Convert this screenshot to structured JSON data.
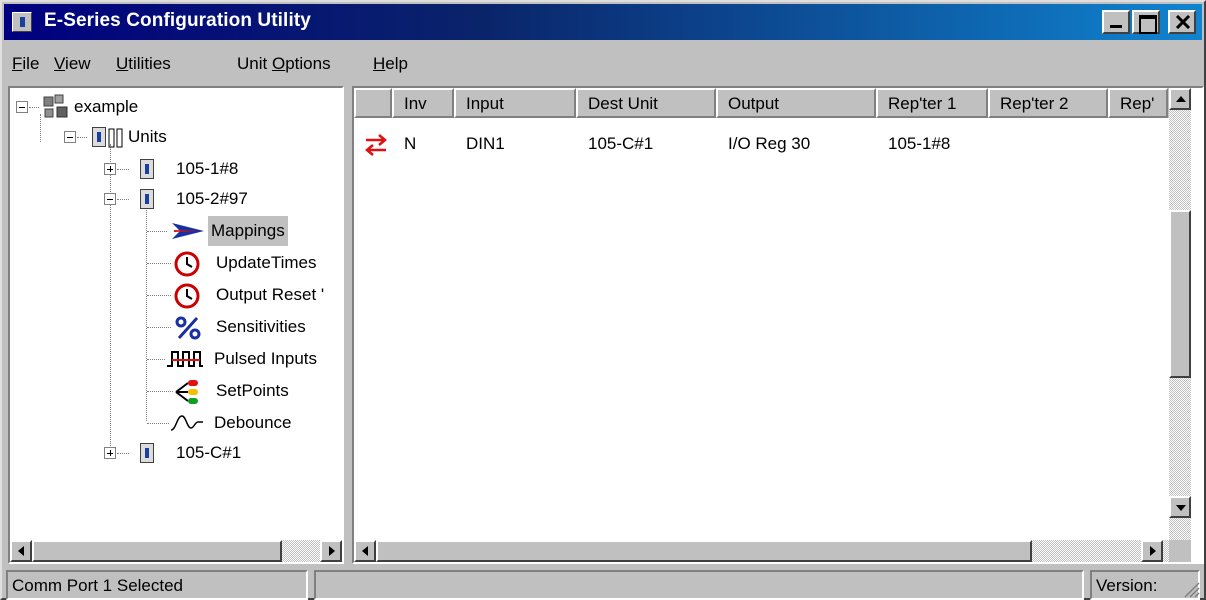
{
  "window": {
    "title": "E-Series Configuration Utility"
  },
  "menu": {
    "items": [
      {
        "label_u": "F",
        "label_rest": "ile"
      },
      {
        "label_u": "V",
        "label_rest": "iew"
      },
      {
        "label_u": "U",
        "label_rest": "tilities"
      },
      {
        "label_pre": "Unit ",
        "label_u": "O",
        "label_rest": "ptions"
      },
      {
        "label_u": "H",
        "label_rest": "elp"
      }
    ]
  },
  "tree": {
    "root": "example",
    "units": "Units",
    "unit_1": "105-1#8",
    "unit_2": "105-2#97",
    "children": [
      "Mappings",
      "UpdateTimes",
      "Output Reset '",
      "Sensitivities",
      "Pulsed Inputs",
      "SetPoints",
      "Debounce"
    ],
    "unit_3": "105-C#1",
    "selected": "Mappings"
  },
  "grid": {
    "columns": [
      "",
      "Inv",
      "Input",
      "Dest Unit",
      "Output",
      "Rep'ter 1",
      "Rep'ter 2",
      "Rep'"
    ],
    "rows": [
      {
        "inv": "N",
        "input": "DIN1",
        "dest_unit": "105-C#1",
        "output": "I/O Reg 30",
        "repeater1": "105-1#8",
        "repeater2": ""
      }
    ]
  },
  "status": {
    "left": "Comm Port 1 Selected",
    "middle": "",
    "right": "Version:"
  },
  "colors": {
    "title_start": "#000080",
    "title_end": "#1084d0",
    "face": "#c0c0c0",
    "mapping_arrow": "#e01010"
  }
}
